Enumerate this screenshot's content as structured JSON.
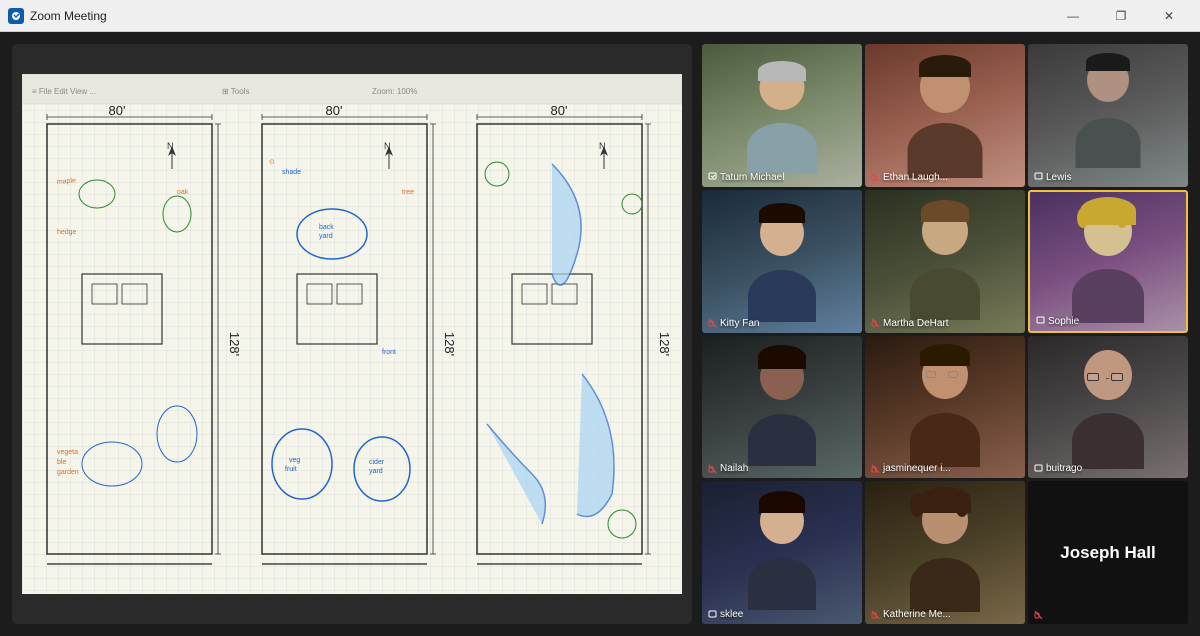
{
  "titleBar": {
    "title": "Zoom Meeting",
    "minimize": "—",
    "maximize": "❐",
    "close": "✕"
  },
  "participants": [
    {
      "id": "tatum",
      "name": "Tatum Michael",
      "muted": false,
      "bg": "bg-room1",
      "active": false,
      "nameColor": "white"
    },
    {
      "id": "ethan",
      "name": "Ethan Laugh...",
      "muted": true,
      "bg": "bg-room2",
      "active": false,
      "nameColor": "white"
    },
    {
      "id": "lewis",
      "name": "Lewis",
      "muted": false,
      "bg": "bg-room3",
      "active": false,
      "nameColor": "white"
    },
    {
      "id": "kittyfan",
      "name": "Kitty Fan",
      "muted": true,
      "bg": "bg-room4",
      "active": false,
      "nameColor": "white"
    },
    {
      "id": "martha",
      "name": "Martha DeHart",
      "muted": true,
      "bg": "bg-room5",
      "active": false,
      "nameColor": "white"
    },
    {
      "id": "sophie",
      "name": "Sophie",
      "muted": false,
      "bg": "bg-room6",
      "active": true,
      "nameColor": "white"
    },
    {
      "id": "nailah",
      "name": "Nailah",
      "muted": true,
      "bg": "bg-room7",
      "active": false,
      "nameColor": "white"
    },
    {
      "id": "jasmine",
      "name": "jasminequer i...",
      "muted": true,
      "bg": "bg-room8",
      "active": false,
      "nameColor": "white"
    },
    {
      "id": "buitrago",
      "name": "buitrago",
      "muted": false,
      "bg": "bg-room9",
      "active": false,
      "nameColor": "white"
    },
    {
      "id": "sklee",
      "name": "sklee",
      "muted": false,
      "bg": "bg-room4",
      "active": false,
      "nameColor": "white"
    },
    {
      "id": "katherine",
      "name": "Katherine Me...",
      "muted": true,
      "bg": "bg-room1",
      "active": false,
      "nameColor": "white"
    },
    {
      "id": "joseph",
      "name": "Joseph Hall",
      "muted": true,
      "bg": "bg-black",
      "active": false,
      "nameColor": "white",
      "noCamera": true
    }
  ],
  "whiteboard": {
    "dimensions": "80' x 128'"
  }
}
